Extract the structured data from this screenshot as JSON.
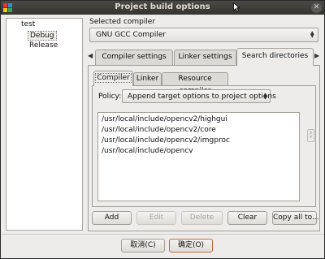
{
  "window": {
    "title": "Project build options"
  },
  "tree": {
    "items": [
      "test",
      "Debug",
      "Release"
    ]
  },
  "compiler": {
    "label": "Selected compiler",
    "value": "GNU GCC Compiler"
  },
  "main_tabs": [
    "Compiler settings",
    "Linker settings",
    "Search directories"
  ],
  "sub_tabs": [
    "Compiler",
    "Linker",
    "Resource compiler"
  ],
  "policy": {
    "label": "Policy:",
    "value": "Append target options to project options"
  },
  "directories": [
    "/usr/local/include/opencv2/highgui",
    "/usr/local/include/opencv2/core",
    "/usr/local/include/opencv2/imgproc",
    "/usr/local/include/opencv"
  ],
  "buttons": {
    "add": "Add",
    "edit": "Edit",
    "delete": "Delete",
    "clear": "Clear",
    "copy": "Copy all to..."
  },
  "dialog_buttons": {
    "cancel": "取消(C)",
    "ok": "确定(O)"
  }
}
